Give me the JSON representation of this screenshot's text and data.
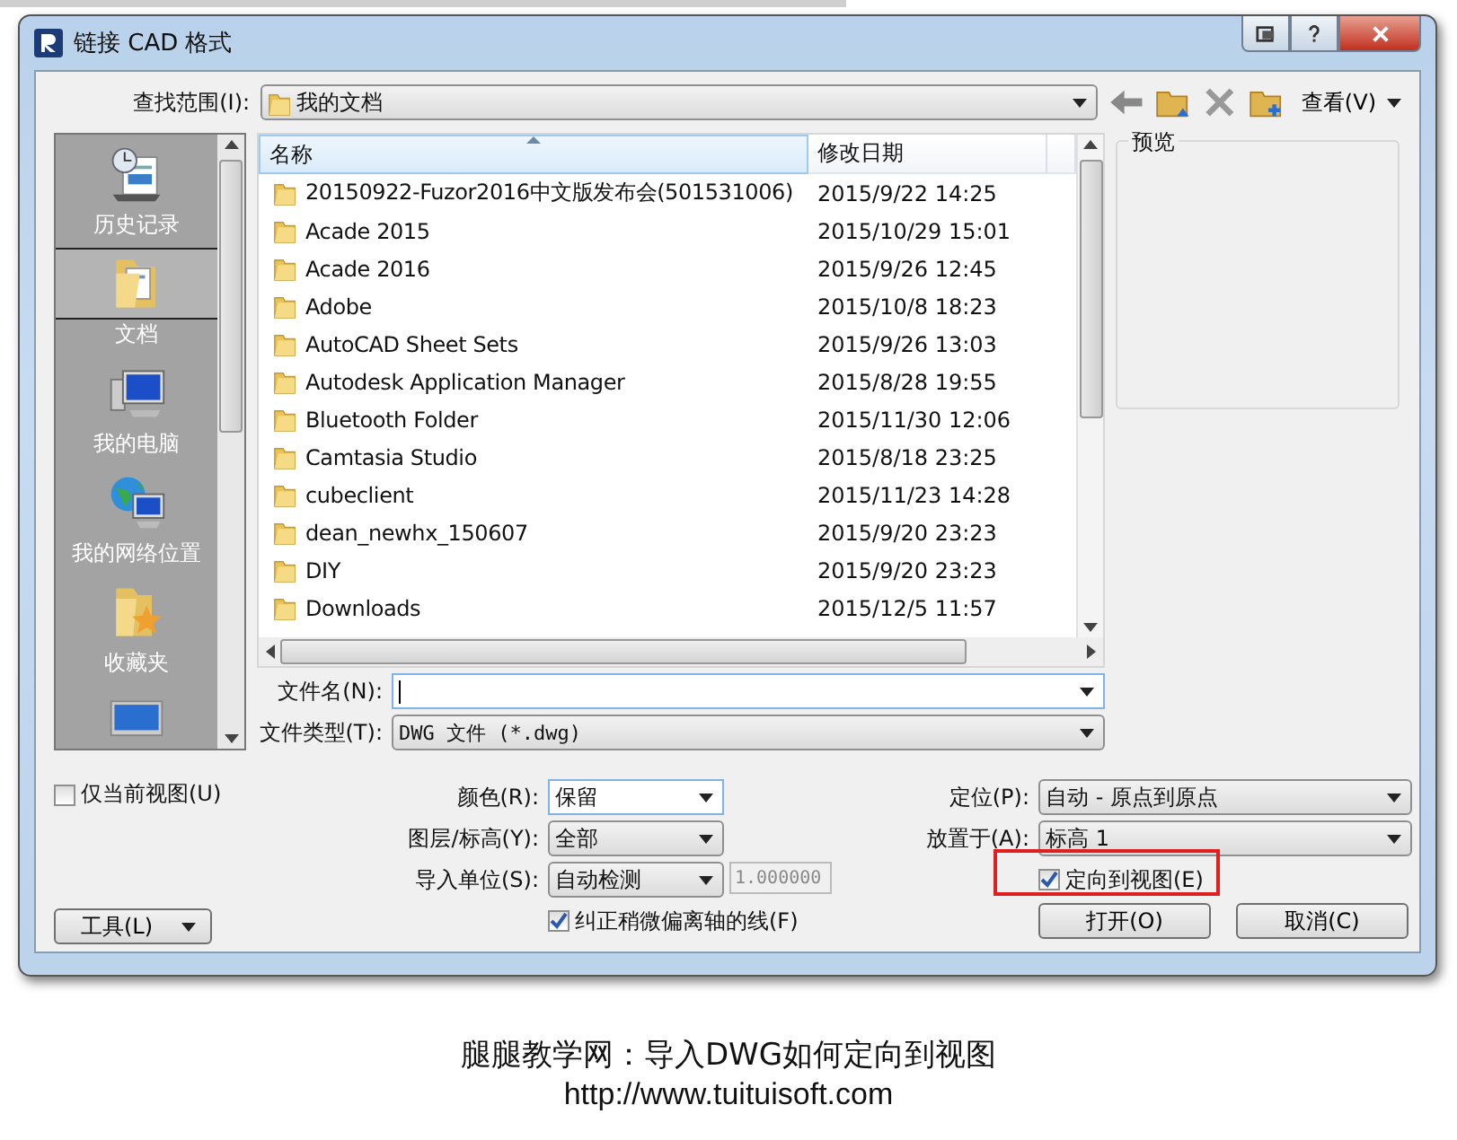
{
  "window": {
    "title": "链接 CAD 格式"
  },
  "look_in": {
    "label": "查找范围(I):",
    "value": "我的文档"
  },
  "toolbar": {
    "view_label": "查看(V)"
  },
  "places": [
    {
      "label": "历史记录",
      "kind": "history",
      "selected": false
    },
    {
      "label": "文档",
      "kind": "documents",
      "selected": true
    },
    {
      "label": "我的电脑",
      "kind": "computer",
      "selected": false
    },
    {
      "label": "我的网络位置",
      "kind": "network",
      "selected": false
    },
    {
      "label": "收藏夹",
      "kind": "favorites",
      "selected": false
    },
    {
      "kind": "desktop",
      "selected": false
    }
  ],
  "file_list": {
    "columns": [
      "名称",
      "修改日期"
    ],
    "rows": [
      {
        "name": "20150922-Fuzor2016中文版发布会(501531006)",
        "modified": "2015/9/22 14:25"
      },
      {
        "name": "Acade 2015",
        "modified": "2015/10/29 15:01"
      },
      {
        "name": "Acade 2016",
        "modified": "2015/9/26 12:45"
      },
      {
        "name": "Adobe",
        "modified": "2015/10/8 18:23"
      },
      {
        "name": "AutoCAD Sheet Sets",
        "modified": "2015/9/26 13:03"
      },
      {
        "name": "Autodesk Application Manager",
        "modified": "2015/8/28 19:55"
      },
      {
        "name": "Bluetooth Folder",
        "modified": "2015/11/30 12:06"
      },
      {
        "name": "Camtasia Studio",
        "modified": "2015/8/18 23:25"
      },
      {
        "name": "cubeclient",
        "modified": "2015/11/23 14:28"
      },
      {
        "name": "dean_newhx_150607",
        "modified": "2015/9/20 23:23"
      },
      {
        "name": "DIY",
        "modified": "2015/9/20 23:23"
      },
      {
        "name": "Downloads",
        "modified": "2015/12/5 11:57"
      }
    ]
  },
  "preview": {
    "label": "预览"
  },
  "file_name": {
    "label": "文件名(N):"
  },
  "file_type": {
    "label": "文件类型(T):",
    "value": "DWG 文件 (*.dwg)"
  },
  "current_view_only": {
    "label": "仅当前视图(U)",
    "checked": false
  },
  "tools_button": "工具(L)",
  "import_options": [
    {
      "label": "颜色(R):",
      "value": "保留",
      "kind": "combo"
    },
    {
      "label": "图层/标高(Y):",
      "value": "全部",
      "kind": "dropdown"
    },
    {
      "label": "导入单位(S):",
      "value": "自动检测",
      "kind": "dropdown",
      "extra_value": "1.000000"
    }
  ],
  "correct_lines": {
    "label": "纠正稍微偏离轴的线(F)",
    "checked": true
  },
  "placement_options": [
    {
      "label": "定位(P):",
      "value": "自动 - 原点到原点"
    },
    {
      "label": "放置于(A):",
      "value": "标高 1"
    }
  ],
  "orient_to_view": {
    "label": "定向到视图(E)",
    "checked": true,
    "highlighted": true
  },
  "buttons": [
    "打开(O)",
    "取消(C)"
  ],
  "caption": {
    "title": "腿腿教学网：导入DWG如何定向到视图",
    "url": "http://www.tuituisoft.com"
  }
}
